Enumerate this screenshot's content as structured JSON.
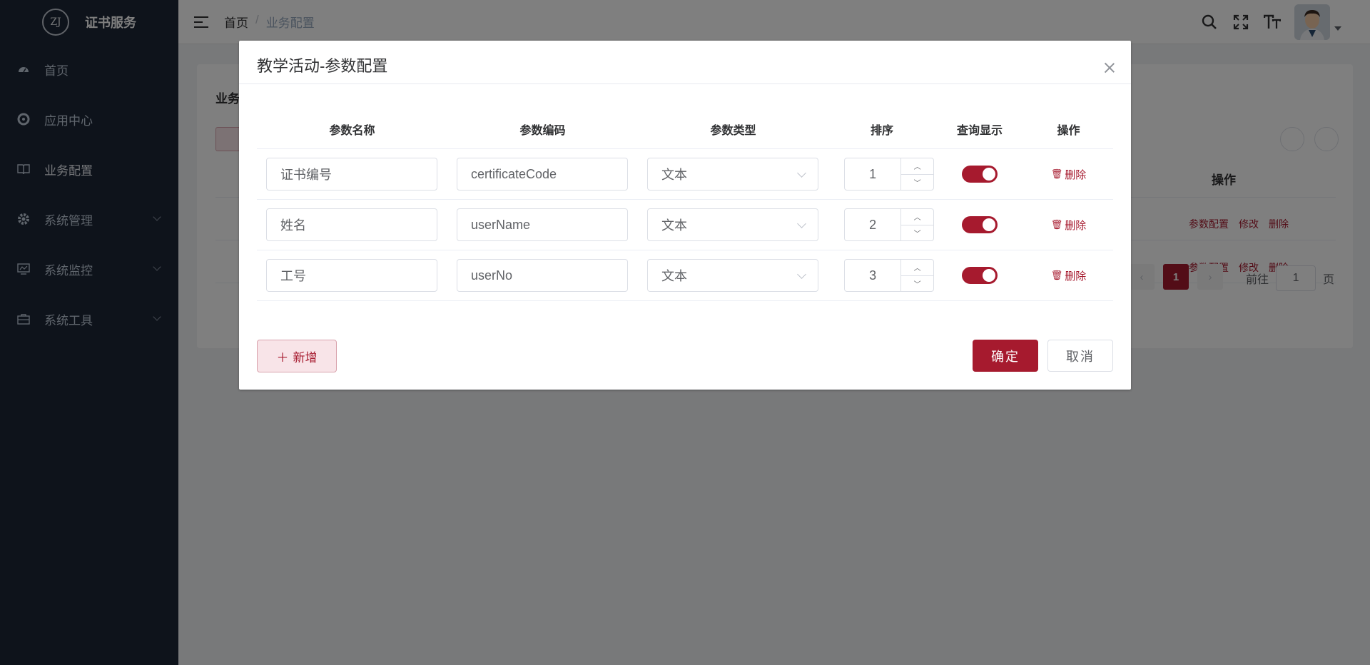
{
  "app": {
    "logo_mark": "ZJ",
    "title": "证书服务"
  },
  "sidebar": {
    "items": [
      {
        "label": "首页",
        "icon": "dashboard-icon"
      },
      {
        "label": "应用中心",
        "icon": "app-center-icon"
      },
      {
        "label": "业务配置",
        "icon": "book-icon"
      },
      {
        "label": "系统管理",
        "icon": "gear-icon"
      },
      {
        "label": "系统监控",
        "icon": "monitor-icon"
      },
      {
        "label": "系统工具",
        "icon": "toolbox-icon"
      }
    ]
  },
  "breadcrumb": {
    "home": "首页",
    "separator": "/",
    "current": "业务配置"
  },
  "background": {
    "card_title": "业务",
    "ops_header": "操作",
    "row_actions": [
      "参数配置",
      "修改",
      "删除"
    ],
    "pagination": {
      "current_page": "1",
      "goto_label": "前往",
      "goto_value": "1",
      "page_unit": "页"
    }
  },
  "dialog": {
    "title": "教学活动-参数配置",
    "columns": [
      "参数名称",
      "参数编码",
      "参数类型",
      "排序",
      "查询显示",
      "操作"
    ],
    "rows": [
      {
        "name": "证书编号",
        "code": "certificateCode",
        "type": "文本",
        "order": "1",
        "show": true,
        "action": "删除"
      },
      {
        "name": "姓名",
        "code": "userName",
        "type": "文本",
        "order": "2",
        "show": true,
        "action": "删除"
      },
      {
        "name": "工号",
        "code": "userNo",
        "type": "文本",
        "order": "3",
        "show": true,
        "action": "删除"
      }
    ],
    "add_label": "新增",
    "confirm_label": "确定",
    "cancel_label": "取消"
  },
  "colors": {
    "accent": "#a61a2e",
    "sidebar_bg": "#1d2637"
  }
}
